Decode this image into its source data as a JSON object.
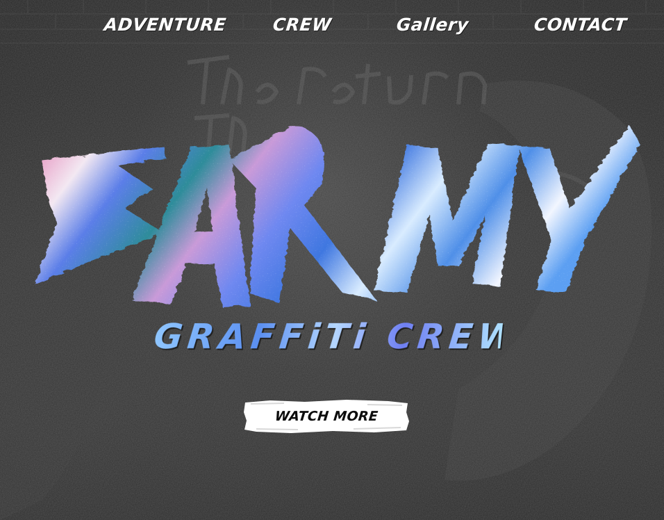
{
  "nav": {
    "items": [
      {
        "label": "ADVENTURE"
      },
      {
        "label": "CREW"
      },
      {
        "label": "Gallery"
      },
      {
        "label": "CONTACT"
      }
    ]
  },
  "hero": {
    "title": "BARMY",
    "subtitle": "GRAFFiTi CREW",
    "cta_label": "WATCH MORE",
    "background_mural_text": "The return of the"
  },
  "colors": {
    "background": "#1e1e1e",
    "nav_text": "#ffffff",
    "title_blue": "#5b8ff0",
    "title_pink": "#e79bc4",
    "title_teal": "#2e8c9a",
    "button_bg": "#ffffff",
    "button_text": "#0d0d0d"
  },
  "icons": [
    "graffiti-logo",
    "brush-stroke-button"
  ]
}
